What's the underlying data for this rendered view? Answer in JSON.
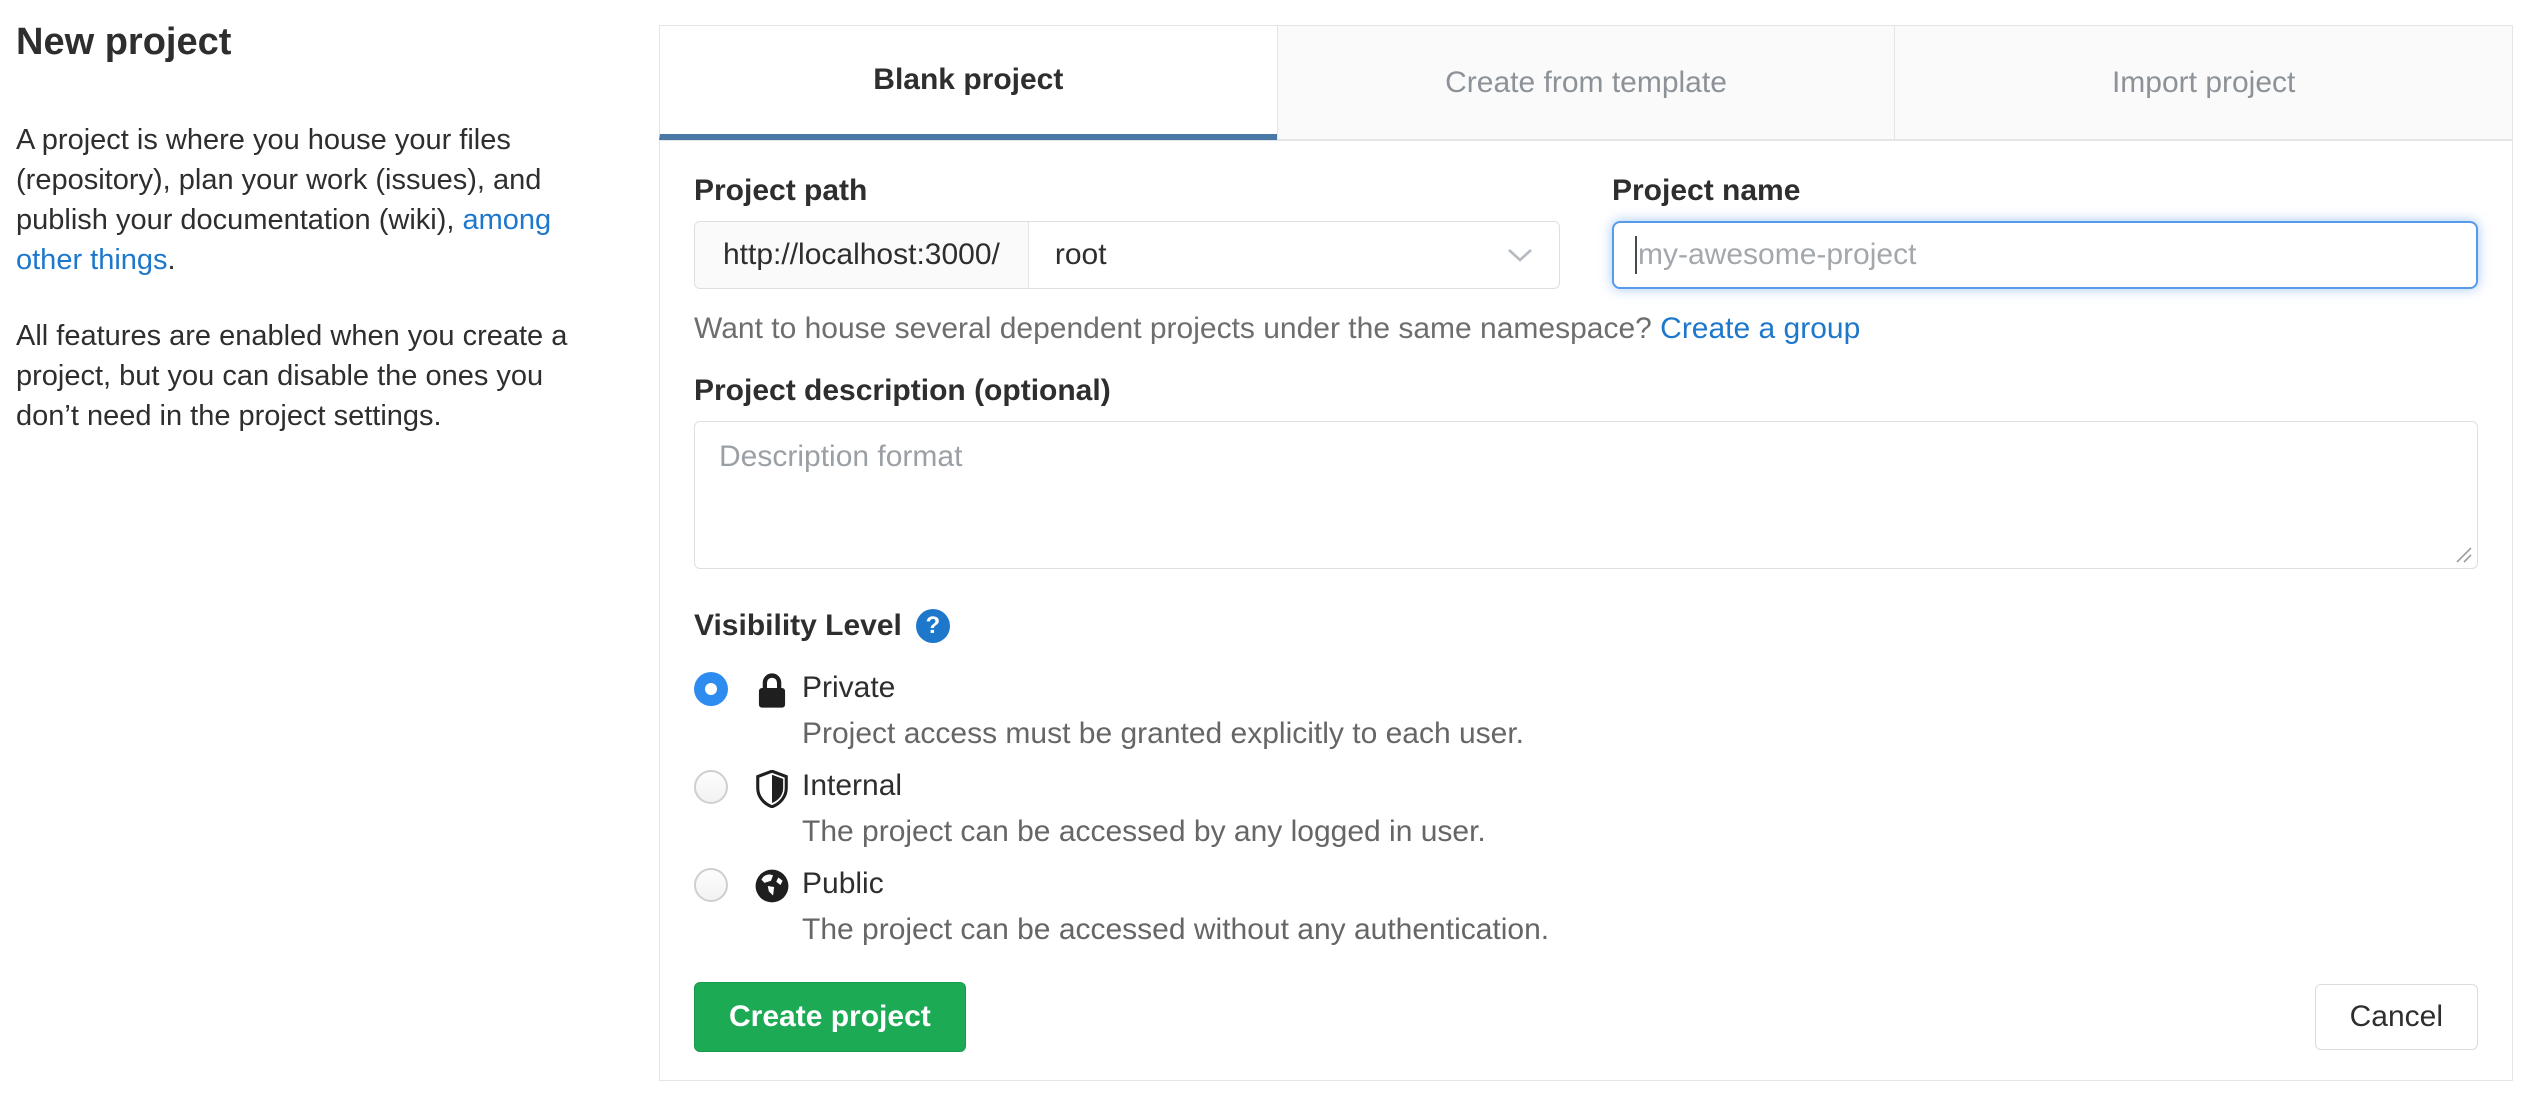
{
  "page": {
    "title": "New project",
    "intro": {
      "before": "A project is where you house your files (repository), plan your work (issues), and publish your documentation (wiki), ",
      "link_text": "among other things",
      "after": "."
    },
    "intro_p2": "All features are enabled when you create a project, but you can disable the ones you don’t need in the project settings."
  },
  "tabs": [
    {
      "label": "Blank project",
      "active": true
    },
    {
      "label": "Create from template",
      "active": false
    },
    {
      "label": "Import project",
      "active": false
    }
  ],
  "form": {
    "project_path": {
      "label": "Project path",
      "url_prefix": "http://localhost:3000/",
      "namespace_selected": "root"
    },
    "project_name": {
      "label": "Project name",
      "placeholder": "my-awesome-project"
    },
    "namespace_help": {
      "text": "Want to house several dependent projects under the same namespace? ",
      "link": "Create a group"
    },
    "description": {
      "label": "Project description (optional)",
      "placeholder": "Description format"
    },
    "visibility": {
      "label": "Visibility Level",
      "help_icon": "question-mark-icon",
      "options": [
        {
          "name": "Private",
          "icon": "lock-icon",
          "selected": true,
          "description": "Project access must be granted explicitly to each user."
        },
        {
          "name": "Internal",
          "icon": "shield-icon",
          "selected": false,
          "description": "The project can be accessed by any logged in user."
        },
        {
          "name": "Public",
          "icon": "globe-icon",
          "selected": false,
          "description": "The project can be accessed without any authentication."
        }
      ]
    },
    "actions": {
      "submit_label": "Create project",
      "cancel_label": "Cancel"
    }
  },
  "colors": {
    "accent_green": "#1caa55",
    "link_blue": "#1d78cb",
    "tab_active_underline": "#4a79a8",
    "radio_selected_blue": "#2e8cf0",
    "focus_border_blue": "#569ae8"
  }
}
